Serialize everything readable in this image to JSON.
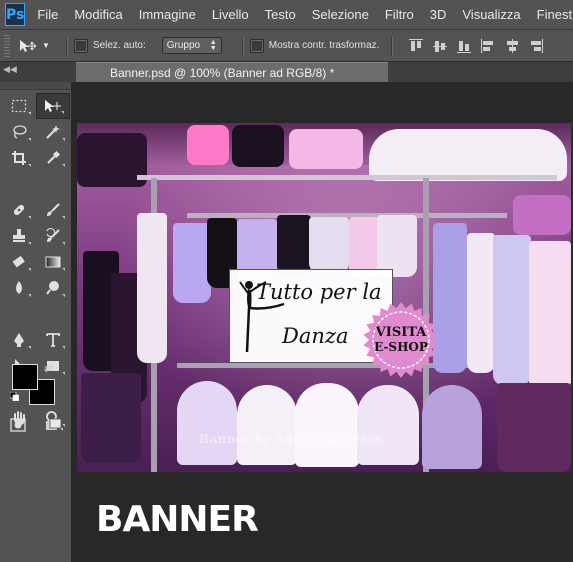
{
  "app": {
    "logo": "Ps"
  },
  "menu": [
    "File",
    "Modifica",
    "Immagine",
    "Livello",
    "Testo",
    "Selezione",
    "Filtro",
    "3D",
    "Visualizza",
    "Finestra"
  ],
  "options": {
    "auto_select_label": "Selez. auto:",
    "group_select": "Gruppo",
    "transform_label": "Mostra contr. trasformaz."
  },
  "document_tab": {
    "label": "Banner.psd @ 100% (Banner ad RGB/8) *"
  },
  "canvas": {
    "script_line1": "Tutto per la",
    "script_line2": "Danza",
    "seal_line1": "VISITA",
    "seal_line2": "E-SHOP",
    "watermark": "Banner by AgapeunoTeam"
  },
  "caption": "BANNER",
  "colors": {
    "foreground": "#000000",
    "background": "#000000",
    "accent": "#e08ad0"
  },
  "icons": [
    "marquee-icon",
    "move-icon",
    "lasso-icon",
    "magic-wand-icon",
    "crop-icon",
    "eyedropper-icon",
    "spot-healing-icon",
    "brush-icon",
    "clone-stamp-icon",
    "history-brush-icon",
    "eraser-icon",
    "gradient-icon",
    "blur-icon",
    "dodge-icon",
    "pen-icon",
    "type-icon",
    "path-selection-icon",
    "rectangle-icon",
    "hand-icon",
    "zoom-icon",
    "quick-mask-icon",
    "screen-mode-icon"
  ]
}
